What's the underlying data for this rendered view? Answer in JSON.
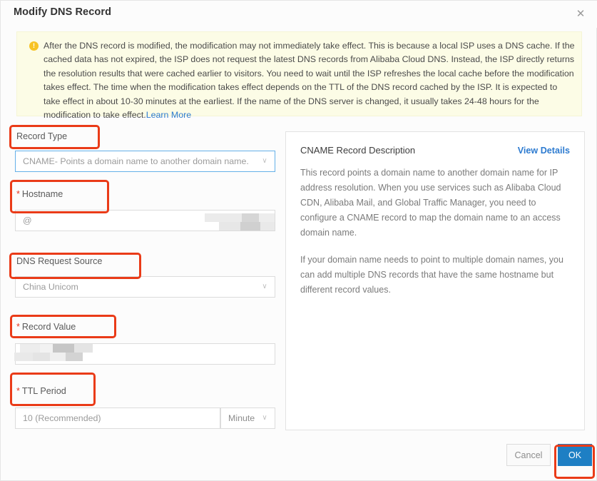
{
  "dialog": {
    "title": "Modify DNS Record",
    "close_icon": "close-icon"
  },
  "banner": {
    "icon": "warning-icon",
    "icon_glyph": "!",
    "text": "After the DNS record is modified, the modification may not immediately take effect. This is because a local ISP uses a DNS cache. If the cached data has not expired, the ISP does not request the latest DNS records from Alibaba Cloud DNS. Instead, the ISP directly returns the resolution results that were cached earlier to visitors. You need to wait until the ISP refreshes the local cache before the modification takes effect. The time when the modification takes effect depends on the TTL of the DNS record cached by the ISP. It is expected to take effect in about 10-30 minutes at the earliest. If the name of the DNS server is changed, it usually takes 24-48 hours for the modification to take effect.",
    "link_label": "Learn More",
    "background_color": "#fcfce6",
    "icon_color": "#f7c325"
  },
  "form": {
    "record_type": {
      "label": "Record Type",
      "required": false,
      "value": "CNAME- Points a domain name to another domain name.",
      "focused": true
    },
    "hostname": {
      "label": "Hostname",
      "required": true,
      "required_marker": "*",
      "value": "@",
      "masked": true
    },
    "dns_request_source": {
      "label": "DNS Request Source",
      "required": false,
      "value": "China Unicom"
    },
    "record_value": {
      "label": "Record Value",
      "required": true,
      "required_marker": "*",
      "value": "",
      "masked": true
    },
    "ttl_period": {
      "label": "TTL Period",
      "required": true,
      "required_marker": "*",
      "value": "10 (Recommended)",
      "unit": "Minute"
    }
  },
  "info_panel": {
    "title": "CNAME Record Description",
    "link_label": "View Details",
    "paragraph_1": "This record points a domain name to another domain name for IP address resolution. When you use services such as Alibaba Cloud CDN, Alibaba Mail, and Global Traffic Manager, you need to configure a CNAME record to map the domain name to an access domain name.",
    "paragraph_2": "If your domain name needs to point to multiple domain names, you can add multiple DNS records that have the same hostname but different record values."
  },
  "footer": {
    "cancel_label": "Cancel",
    "ok_label": "OK",
    "ok_color": "#1e7fc4"
  },
  "annotations": {
    "highlight_color": "#ea3b18",
    "boxes": [
      "record-type-label",
      "hostname-label",
      "dns-request-source-label",
      "record-value-label",
      "ttl-period-label",
      "ok-button"
    ]
  },
  "icons": {
    "chevron_down": "∨"
  }
}
